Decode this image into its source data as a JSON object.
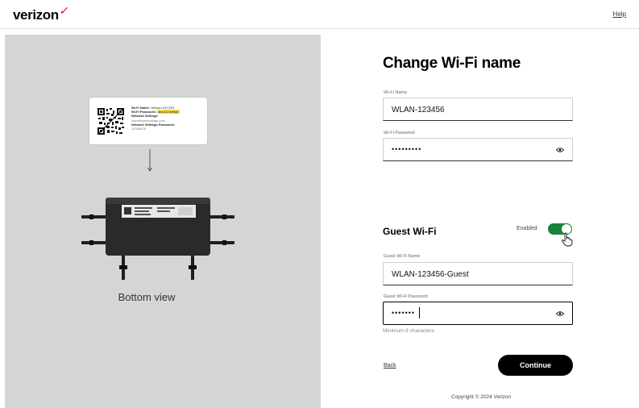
{
  "header": {
    "logo_text": "verizon",
    "logo_mark": "✓",
    "help_label": "Help"
  },
  "illustration": {
    "label_card": {
      "wifi_name_key": "Wi-Fi Name:",
      "wifi_name_value": "Verizon-X1Y2Z3",
      "wifi_password_key": "Wi-Fi Password:",
      "wifi_password_value": "abcd1234efgh",
      "network_settings_key": "Network Settings",
      "network_settings_url": "mynetworksettings.com",
      "network_settings_password_key": "Network Settings Password:",
      "network_settings_password_value": "12345678"
    },
    "caption": "Bottom view"
  },
  "form": {
    "title": "Change Wi-Fi name",
    "wifi_name": {
      "label": "Wi-Fi Name",
      "value": "WLAN-123456"
    },
    "wifi_password": {
      "label": "Wi-Fi Password",
      "value": "•••••••••"
    },
    "guest": {
      "title": "Guest Wi-Fi",
      "toggle_label": "Enabled",
      "toggle_state": "on",
      "name_label": "Guest Wi-Fi Name",
      "name_value": "WLAN-123456-Guest",
      "password_label": "Guest Wi-Fi Password",
      "password_value": "•••••••",
      "password_hint": "Minimum 8 characters"
    },
    "back_label": "Back",
    "continue_label": "Continue"
  },
  "footer": {
    "copyright": "Copyright © 2024 Verizon"
  },
  "icons": {
    "eye": "eye-icon",
    "cursor": "hand-cursor-icon",
    "arrow": "arrow-down-icon",
    "qr": "qr-code-icon"
  },
  "colors": {
    "brand_red": "#ee0000",
    "toggle_green": "#18833c",
    "panel_gray": "#d4d6d5",
    "button_black": "#000000"
  }
}
